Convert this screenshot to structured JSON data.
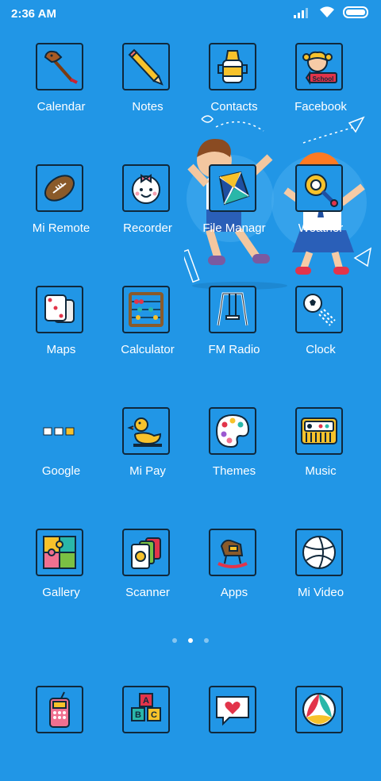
{
  "status_bar": {
    "time": "2:36 AM"
  },
  "pager": {
    "pages": 3,
    "active_index": 1
  },
  "apps": [
    {
      "label": "Calendar",
      "icon": "hobby-horse-icon"
    },
    {
      "label": "Notes",
      "icon": "pencil-icon"
    },
    {
      "label": "Contacts",
      "icon": "sippy-cup-icon"
    },
    {
      "label": "Facebook",
      "icon": "school-girl-icon"
    },
    {
      "label": "Mi Remote",
      "icon": "football-icon"
    },
    {
      "label": "Recorder",
      "icon": "baby-face-icon"
    },
    {
      "label": "File Managr",
      "icon": "kite-icon"
    },
    {
      "label": "Weather",
      "icon": "rattle-icon"
    },
    {
      "label": "Maps",
      "icon": "dice-icon"
    },
    {
      "label": "Calculator",
      "icon": "abacus-icon"
    },
    {
      "label": "FM Radio",
      "icon": "swing-icon"
    },
    {
      "label": "Clock",
      "icon": "soccer-ball-icon"
    },
    {
      "label": "Google",
      "icon": "google-folder-icon"
    },
    {
      "label": "Mi Pay",
      "icon": "rubber-duck-icon"
    },
    {
      "label": "Themes",
      "icon": "palette-icon"
    },
    {
      "label": "Music",
      "icon": "toy-piano-icon"
    },
    {
      "label": "Gallery",
      "icon": "puzzle-icon"
    },
    {
      "label": "Scanner",
      "icon": "cards-icon"
    },
    {
      "label": "Apps",
      "icon": "rocking-horse-icon"
    },
    {
      "label": "Mi Video",
      "icon": "volleyball-icon"
    }
  ],
  "dock": [
    {
      "icon": "toy-phone-icon"
    },
    {
      "icon": "abc-blocks-icon"
    },
    {
      "icon": "heart-message-icon"
    },
    {
      "icon": "beach-ball-icon"
    }
  ],
  "wallpaper": {
    "school_sign": "School"
  }
}
